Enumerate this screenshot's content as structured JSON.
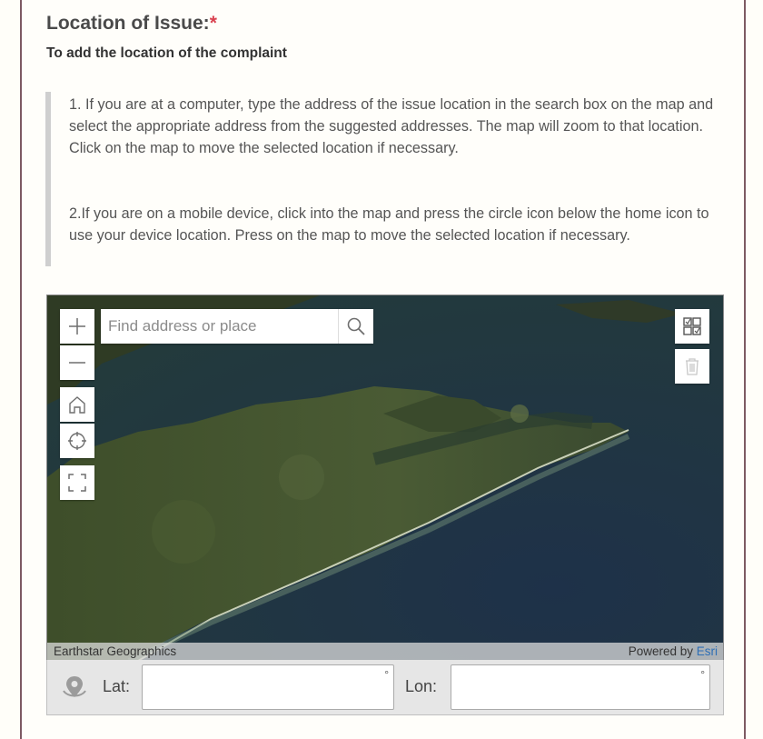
{
  "question": {
    "title": "Location of Issue:",
    "required_mark": "*",
    "subtitle": "To add the location of the complaint"
  },
  "instructions": {
    "paragraph_1": "1. If you are at a computer, type the address of the issue location in the search box on the map and select the appropriate address from the suggested addresses. The map will zoom to that location. Click on the map to move the selected location if necessary.",
    "paragraph_2": "2.If you are on a mobile device, click into the map and press the circle icon below the home icon to use your device location. Press on the map to move the selected location if necessary."
  },
  "map": {
    "search_placeholder": "Find address or place",
    "attribution_left": "Earthstar Geographics",
    "powered_by": "Powered by",
    "powered_by_link": "Esri",
    "controls": [
      "zoom-in-icon",
      "zoom-out-icon",
      "home-icon",
      "locate-icon",
      "fullscreen-icon",
      "search-icon",
      "select-tool-icon",
      "trash-icon"
    ]
  },
  "coordinates": {
    "lat_label": "Lat:",
    "lon_label": "Lon:",
    "degree_symbol": "°",
    "lat_value": "",
    "lon_value": ""
  },
  "colors": {
    "required": "#d9414f",
    "card_border": "#7d5a63",
    "esri_link": "#2e6fb5"
  }
}
